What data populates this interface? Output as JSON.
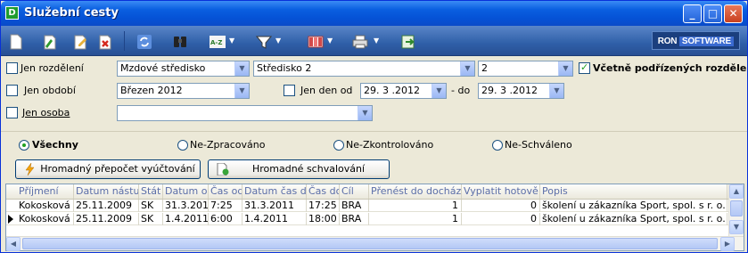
{
  "window": {
    "title": "Služební cesty",
    "app_icon": "D"
  },
  "title_buttons": {
    "minimize": "_",
    "maximize": "□",
    "close": "✕"
  },
  "toolbar": {
    "icons": [
      "new-doc-icon",
      "edit-doc-icon",
      "edit-pencil-icon",
      "delete-icon",
      "refresh-icon",
      "binoculars-icon",
      "sort-icon",
      "filter-icon",
      "columns-icon",
      "print-icon",
      "export-icon"
    ],
    "sort_label": "A-Z",
    "brand_ron": "RON",
    "brand_soft": "SOFTWARE"
  },
  "filters": {
    "jen_rozdeleni": {
      "label": "Jen rozdělení",
      "checked": false
    },
    "rozdeleni_combo": "Mzdové středisko",
    "stredisko_combo": "Středisko 2",
    "value_combo": "2",
    "vcetne": {
      "label": "Včetně podřízených rozdělení",
      "checked": true
    },
    "jen_obdobi": {
      "label": "Jen období",
      "checked": false
    },
    "obdobi_combo": "Březen 2012",
    "jen_den_od": {
      "label": "Jen den od",
      "checked": false
    },
    "den_od": "29. 3 .2012",
    "do_label": "- do",
    "den_do": "29. 3 .2012",
    "jen_osoba": {
      "label": "Jen osoba",
      "checked": false
    },
    "osoba_combo": ""
  },
  "radios": [
    {
      "label": "Všechny",
      "selected": true
    },
    {
      "label": "Ne-Zpracováno",
      "selected": false
    },
    {
      "label": "Ne-Zkontrolováno",
      "selected": false
    },
    {
      "label": "Ne-Schváleno",
      "selected": false
    }
  ],
  "actions": {
    "prepocet": "Hromadný přepočet vyúčtování",
    "schvaleni": "Hromadné schvalování"
  },
  "grid": {
    "columns": [
      "Příjmení",
      "Datum nástupu",
      "Stát",
      "Datum od",
      "Čas od",
      "Datum čas do",
      "Čas do",
      "Cíl",
      "Přenést do docházky",
      "Vyplatit hotově",
      "Popis"
    ],
    "rows": [
      [
        "Kokosková",
        "25.11.2009",
        "SK",
        "31.3.2011",
        "7:25",
        "31.3.2011",
        "17:25",
        "BRA",
        "1",
        "0",
        "školení u zákazníka Sport, spol. s r. o."
      ],
      [
        "Kokosková",
        "25.11.2009",
        "SK",
        "1.4.2011",
        "6:00",
        "1.4.2011",
        "18:00",
        "BRA",
        "1",
        "0",
        "školení u zákazníka Sport, spol. s r. o."
      ]
    ],
    "current_row": 1
  }
}
